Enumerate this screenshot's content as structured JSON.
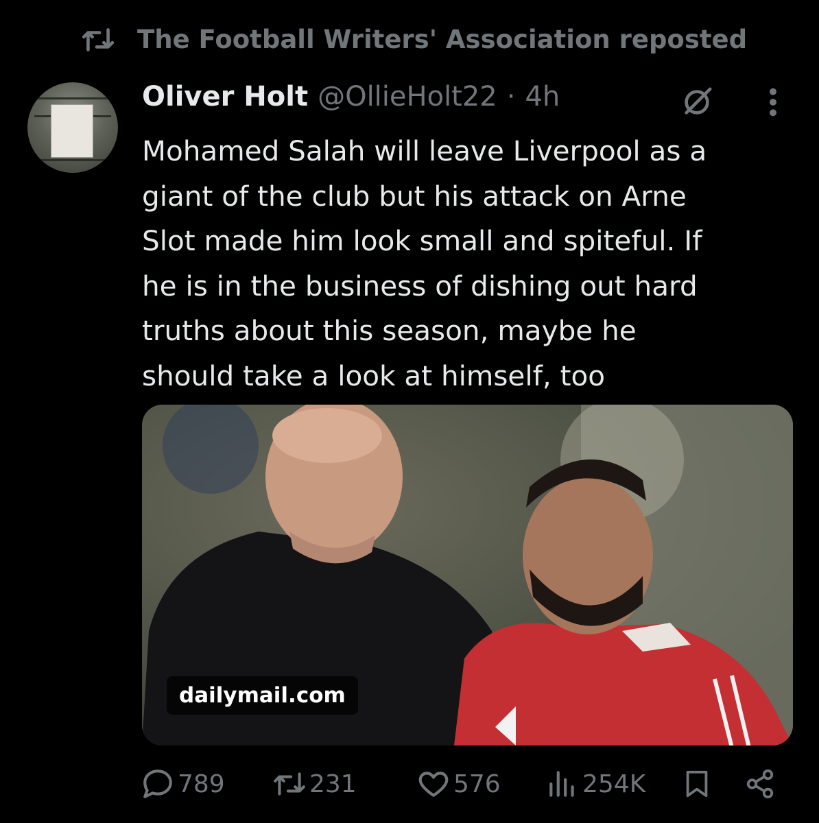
{
  "repost_banner": {
    "text": "The Football Writers' Association reposted",
    "icon": "repost-icon"
  },
  "author": {
    "name": "Oliver Holt",
    "handle": "@OllieHolt22",
    "separator": "·",
    "time": "4h"
  },
  "tweet": {
    "text": "Mohamed Salah will leave Liverpool as a\ngiant of the club but his attack on Arne\nSlot made him look small and spiteful. If\nhe is in the business of dishing out hard\ntruths about this season, maybe he\nshould take a look at himself, too"
  },
  "link_card": {
    "domain": "dailymail.com"
  },
  "actions": {
    "replies": "789",
    "reposts": "231",
    "likes": "576",
    "views": "254K"
  },
  "colors": {
    "background": "#000000",
    "text": "#e7e9ea",
    "muted": "#71767b"
  }
}
